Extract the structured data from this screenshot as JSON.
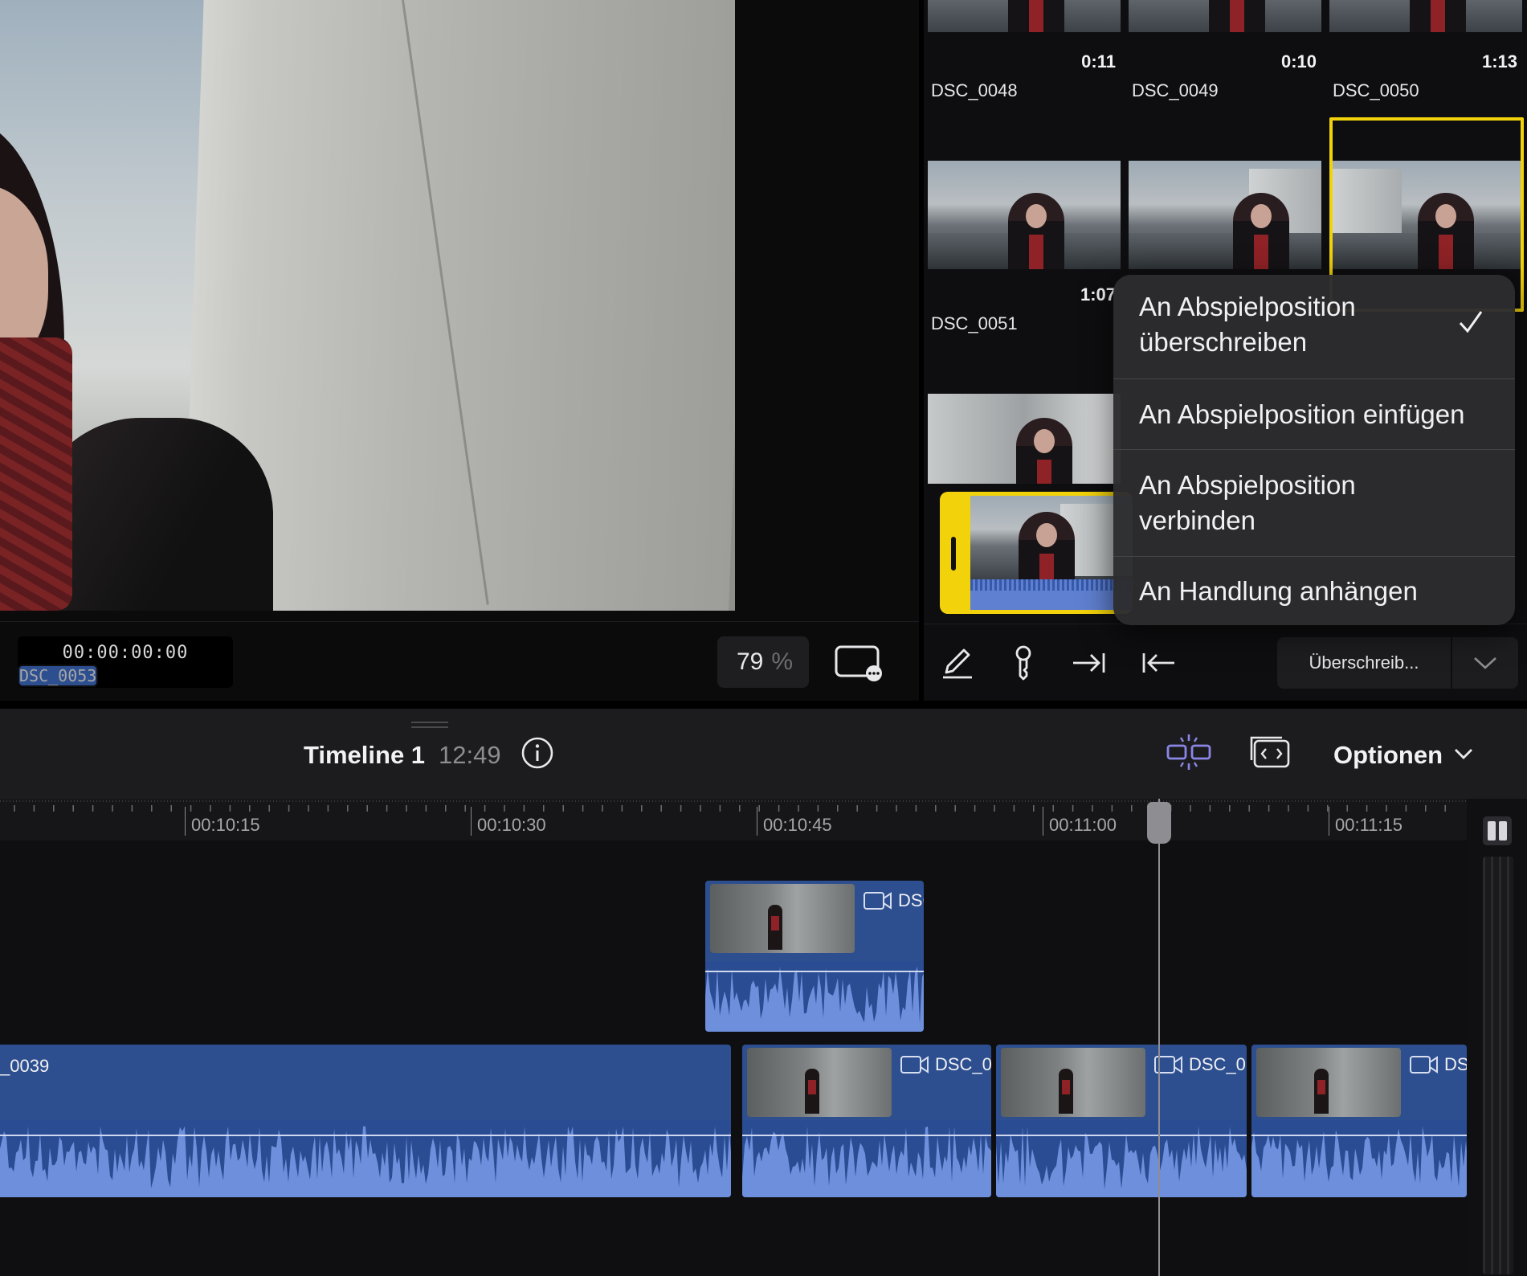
{
  "viewer": {
    "timecode": "00:00:00:00",
    "clip_name": "DSC_0053",
    "zoom_value": "79",
    "zoom_unit": "%"
  },
  "browser": {
    "clips": [
      {
        "name": "DSC_0048",
        "duration": "0:11"
      },
      {
        "name": "DSC_0049",
        "duration": "0:10"
      },
      {
        "name": "DSC_0050",
        "duration": "1:13"
      },
      {
        "name": "DSC_0051",
        "duration": "1:07"
      }
    ],
    "selected_clip": "third-row-2-right",
    "tools": {
      "edit_mode_label": "Überschreib..."
    }
  },
  "edit_menu": {
    "items": [
      {
        "label": "An Abspielposition überschreiben",
        "checked": true
      },
      {
        "label": "An Abspielposition einfügen",
        "checked": false
      },
      {
        "label": "An Abspielposition verbinden",
        "checked": false
      },
      {
        "label": "An Handlung anhängen",
        "checked": false
      }
    ]
  },
  "timeline": {
    "title": "Timeline 1",
    "duration": "12:49",
    "options_label": "Optionen",
    "ruler": [
      "00:10:15",
      "00:10:30",
      "00:10:45",
      "00:11:00",
      "00:11:15"
    ],
    "connected_clip": {
      "name": "DSC"
    },
    "primary_clips": [
      {
        "name": "_0039"
      },
      {
        "name": "DSC_0"
      },
      {
        "name": "DSC_0"
      },
      {
        "name": "DS"
      }
    ]
  },
  "colors": {
    "selection_yellow": "#f2d20a",
    "clip_blue": "#2d4f8f",
    "audio_blue": "#6e8fdc",
    "snap_accent": "#8a86e6"
  }
}
